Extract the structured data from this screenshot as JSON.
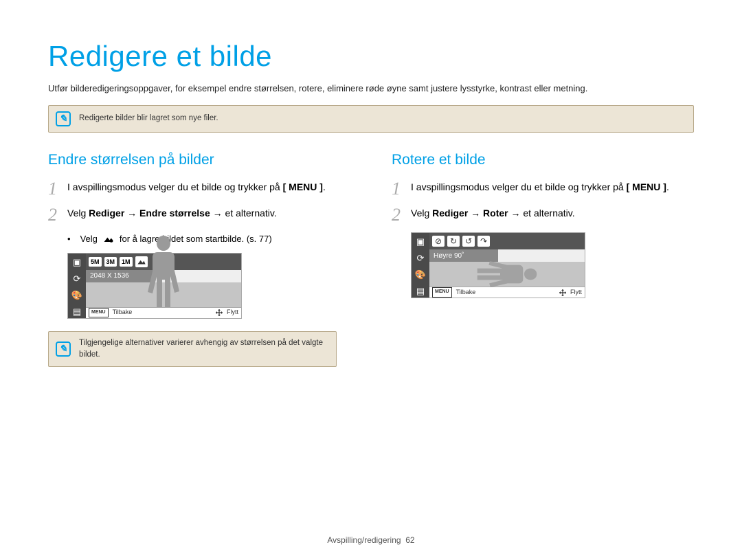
{
  "title": "Redigere et bilde",
  "intro": "Utfør bilderedigeringsoppgaver, for eksempel endre størrelsen, rotere, eliminere røde øyne samt justere lysstyrke, kontrast eller metning.",
  "note_top": "Redigerte bilder blir lagret som nye filer.",
  "left": {
    "heading": "Endre størrelsen på bilder",
    "step1_a": "I avspillingsmodus velger du et bilde og trykker på ",
    "step1_menu": "[ MENU ]",
    "step1_dot": ".",
    "step2_prefix": "Velg ",
    "step2_b1": "Rediger",
    "step2_arrow1": " → ",
    "step2_b2": "Endre størrelse",
    "step2_arrow2": " → ",
    "step2_suffix": "et alternativ.",
    "bullet_a": "Velg ",
    "bullet_b": " for å lagre bildet som startbilde. (s. 77)",
    "cam_opts": [
      "5M",
      "3M",
      "1M"
    ],
    "cam_label": "2048 X 1536",
    "cam_back": "Tilbake",
    "cam_move": "Flytt",
    "cam_menu": "MENU",
    "note_bottom": "Tilgjengelige alternativer varierer avhengig av størrelsen på det valgte bildet."
  },
  "right": {
    "heading": "Rotere et bilde",
    "step1_a": "I avspillingsmodus velger du et bilde og trykker på ",
    "step1_menu": "[ MENU ]",
    "step1_dot": ".",
    "step2_prefix": "Velg ",
    "step2_b1": "Rediger",
    "step2_arrow1": " → ",
    "step2_b2": "Roter",
    "step2_arrow2": " → ",
    "step2_suffix": "et alternativ.",
    "cam_label": "Høyre 90˚",
    "cam_back": "Tilbake",
    "cam_move": "Flytt",
    "cam_menu": "MENU"
  },
  "footer_section": "Avspilling/redigering",
  "footer_page": "62"
}
